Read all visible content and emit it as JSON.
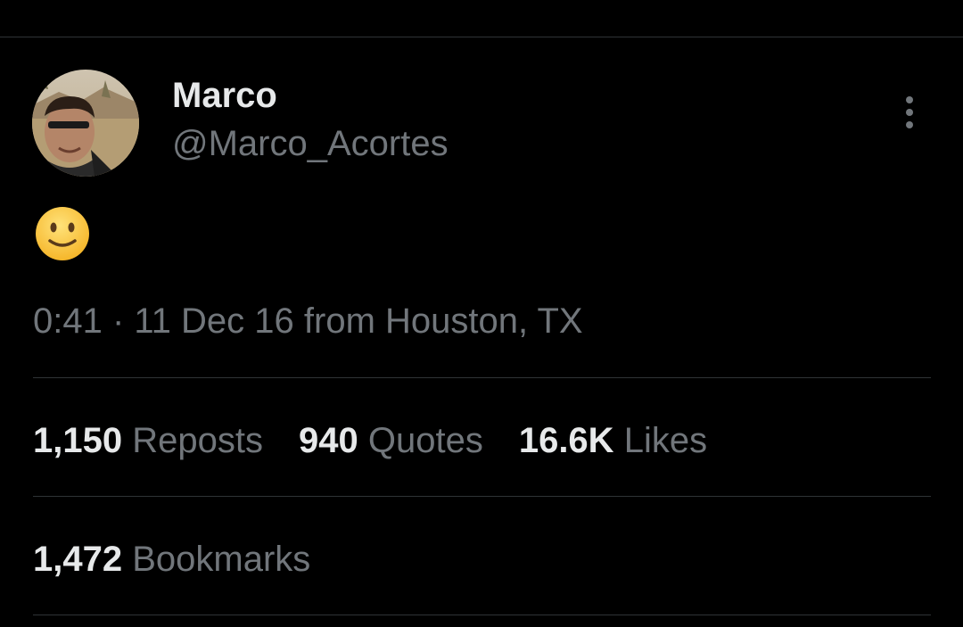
{
  "tweet": {
    "author": {
      "display_name": "Marco",
      "handle": "@Marco_Acortes"
    },
    "text_emoji": "slightly-smiling-face",
    "meta": "0:41 · 11 Dec 16 from Houston, TX"
  },
  "stats": {
    "reposts": {
      "count": "1,150",
      "label": "Reposts"
    },
    "quotes": {
      "count": "940",
      "label": "Quotes"
    },
    "likes": {
      "count": "16.6K",
      "label": "Likes"
    },
    "bookmarks": {
      "count": "1,472",
      "label": "Bookmarks"
    }
  },
  "colors": {
    "background": "#000000",
    "primary_text": "#e7e9ea",
    "secondary_text": "#71767b",
    "divider": "#2f3336"
  }
}
